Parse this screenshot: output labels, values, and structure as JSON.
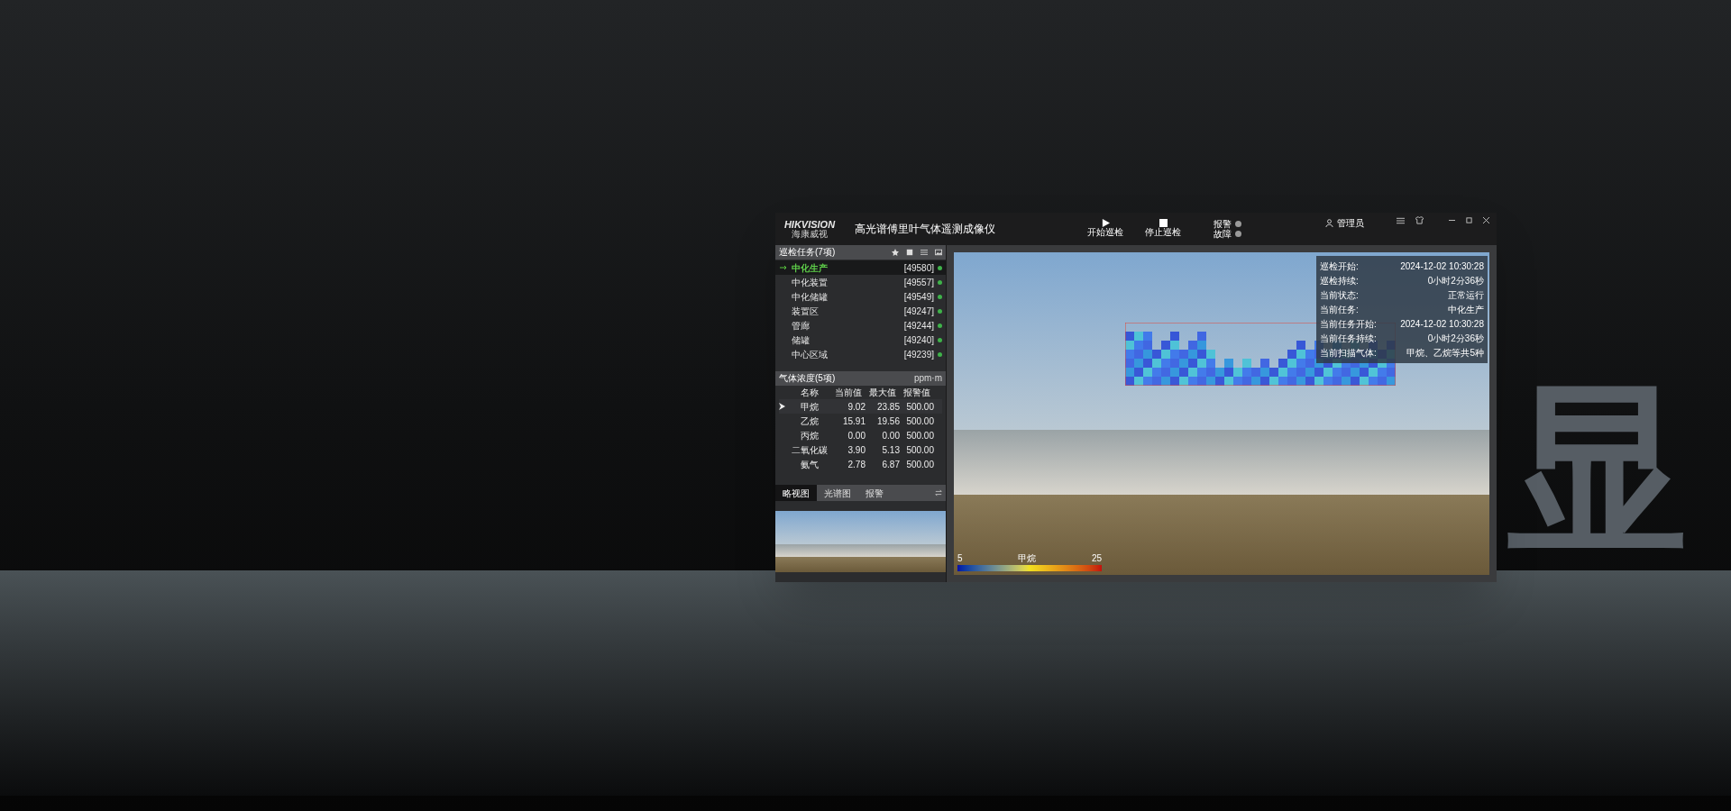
{
  "backdrop": {
    "glyph": "显"
  },
  "app": {
    "logo": {
      "brand": "HIKVISION",
      "brand_cn": "海康威视"
    },
    "title": "高光谱傅里叶气体遥测成像仪",
    "actions": [
      {
        "label": "开始巡检",
        "kind": "play"
      },
      {
        "label": "停止巡检",
        "kind": "stop"
      }
    ],
    "indicators": [
      {
        "label": "报警",
        "on": false
      },
      {
        "label": "故障",
        "on": false
      }
    ],
    "user": "管理员"
  },
  "tasks": {
    "title": "巡检任务(7项)",
    "items": [
      {
        "name": "中化生产",
        "code": "[49580]",
        "selected": true
      },
      {
        "name": "中化装置",
        "code": "[49557]",
        "selected": false
      },
      {
        "name": "中化储罐",
        "code": "[49549]",
        "selected": false
      },
      {
        "name": "装置区",
        "code": "[49247]",
        "selected": false
      },
      {
        "name": "管廊",
        "code": "[49244]",
        "selected": false
      },
      {
        "name": "储罐",
        "code": "[49240]",
        "selected": false
      },
      {
        "name": "中心区域",
        "code": "[49239]",
        "selected": false
      }
    ]
  },
  "gas": {
    "title": "气体浓度(5项)",
    "unit": "ppm·m",
    "columns": [
      "名称",
      "当前值",
      "最大值",
      "报警值"
    ],
    "rows": [
      {
        "cells": [
          "甲烷",
          "9.02",
          "23.85",
          "500.00"
        ],
        "selected": true
      },
      {
        "cells": [
          "乙烷",
          "15.91",
          "19.56",
          "500.00"
        ],
        "selected": false
      },
      {
        "cells": [
          "丙烷",
          "0.00",
          "0.00",
          "500.00"
        ],
        "selected": false
      },
      {
        "cells": [
          "二氧化碳",
          "3.90",
          "5.13",
          "500.00"
        ],
        "selected": false
      },
      {
        "cells": [
          "氨气",
          "2.78",
          "6.87",
          "500.00"
        ],
        "selected": false
      }
    ]
  },
  "view_tabs": [
    {
      "label": "略视图",
      "selected": true
    },
    {
      "label": "光谱图",
      "selected": false
    },
    {
      "label": "报警",
      "selected": false
    }
  ],
  "info": [
    {
      "label": "巡检开始:",
      "value": "2024-12-02 10:30:28"
    },
    {
      "label": "巡检持续:",
      "value": "0小时2分36秒"
    },
    {
      "label": "当前状态:",
      "value": "正常运行"
    },
    {
      "label": "当前任务:",
      "value": "中化生产"
    },
    {
      "label": "当前任务开始:",
      "value": "2024-12-02 10:30:28"
    },
    {
      "label": "当前任务持续:",
      "value": "0小时2分36秒"
    },
    {
      "label": "当前扫描气体:",
      "value": "甲烷、乙烷等共5种"
    }
  ],
  "legend": {
    "min": "5",
    "gas": "甲烷",
    "max": "25"
  }
}
